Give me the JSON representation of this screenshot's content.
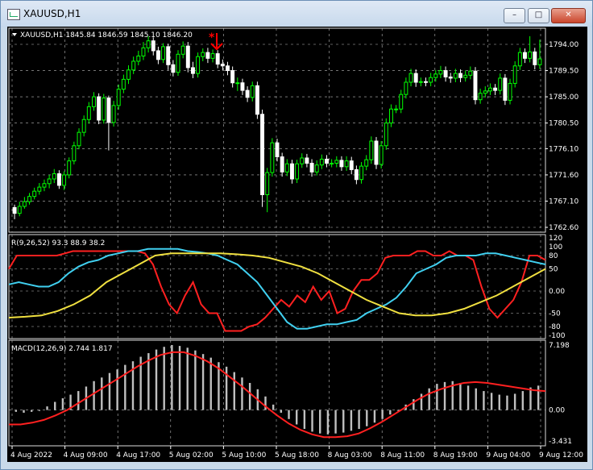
{
  "window": {
    "title": "XAUUSD,H1",
    "buttons": {
      "minimize": "–",
      "maximize": "□",
      "close": "✕"
    }
  },
  "price_panel": {
    "header": "XAUUSD,H1  1845.84 1846.59 1845.10 1846.20",
    "price_labels": [
      "1794.00",
      "1789.50",
      "1785.00",
      "1780.50",
      "1776.10",
      "1771.60",
      "1767.10",
      "1762.60"
    ]
  },
  "indicator_panel": {
    "header": "R(9,26,52) 93.3 88.9 38.2",
    "levels": [
      "120",
      "100",
      "80",
      "50",
      "0.00",
      "-50",
      "-80",
      "-100"
    ]
  },
  "macd_panel": {
    "header": "MACD(12,26,9) 2.744 1.817",
    "levels": [
      "7.198",
      "0.00",
      "-3.431"
    ]
  },
  "time_axis": [
    "4 Aug 2022",
    "4 Aug 09:00",
    "4 Aug 17:00",
    "5 Aug 02:00",
    "5 Aug 10:00",
    "5 Aug 18:00",
    "8 Aug 03:00",
    "8 Aug 11:00",
    "8 Aug 19:00",
    "9 Aug 04:00",
    "9 Aug 12:00"
  ],
  "colors": {
    "bull": "#00ff00",
    "bear": "#ffffff",
    "grid": "#bbbbbb",
    "red": "#ff2020",
    "cyan": "#40d0f0",
    "yellow": "#f0e040",
    "hist": "#c0c0c0",
    "macd_signal": "#ff2020",
    "arrow": "#ff0000"
  },
  "chart_data": [
    {
      "type": "candlestick",
      "title": "XAUUSD,H1",
      "ylim": [
        1762.6,
        1794.0
      ],
      "x": [
        "4 Aug 2022",
        "4 Aug 09:00",
        "4 Aug 17:00",
        "5 Aug 02:00",
        "5 Aug 10:00",
        "5 Aug 18:00",
        "8 Aug 03:00",
        "8 Aug 11:00",
        "8 Aug 19:00",
        "9 Aug 04:00",
        "9 Aug 12:00"
      ],
      "candles": [
        [
          1766.0,
          1765.0,
          1764.0,
          1766.5
        ],
        [
          1765.0,
          1766.2,
          1764.5,
          1767.0
        ],
        [
          1766.2,
          1767.0,
          1765.8,
          1767.8
        ],
        [
          1767.0,
          1767.9,
          1766.5,
          1768.5
        ],
        [
          1767.9,
          1768.8,
          1767.4,
          1769.4
        ],
        [
          1768.8,
          1769.5,
          1768.2,
          1770.2
        ],
        [
          1769.5,
          1770.1,
          1768.8,
          1770.8
        ],
        [
          1770.1,
          1770.9,
          1769.3,
          1771.6
        ],
        [
          1770.9,
          1771.8,
          1770.2,
          1772.6
        ],
        [
          1771.8,
          1769.8,
          1769.2,
          1772.4
        ],
        [
          1769.8,
          1771.6,
          1769.0,
          1772.2
        ],
        [
          1771.6,
          1774.0,
          1771.0,
          1774.6
        ],
        [
          1774.0,
          1776.6,
          1773.4,
          1777.3
        ],
        [
          1776.6,
          1778.9,
          1776.0,
          1779.6
        ],
        [
          1778.9,
          1781.1,
          1778.2,
          1781.8
        ],
        [
          1781.1,
          1783.3,
          1780.4,
          1784.1
        ],
        [
          1783.3,
          1785.0,
          1782.6,
          1785.8
        ],
        [
          1785.0,
          1781.0,
          1780.3,
          1785.6
        ],
        [
          1781.0,
          1784.8,
          1780.4,
          1785.5
        ],
        [
          1784.8,
          1780.6,
          1775.8,
          1785.2
        ],
        [
          1780.6,
          1783.5,
          1779.9,
          1784.3
        ],
        [
          1783.5,
          1786.3,
          1782.8,
          1787.1
        ],
        [
          1786.3,
          1788.0,
          1785.6,
          1788.8
        ],
        [
          1788.0,
          1789.6,
          1787.2,
          1790.4
        ],
        [
          1789.6,
          1791.1,
          1788.9,
          1791.9
        ],
        [
          1791.1,
          1792.0,
          1790.4,
          1792.9
        ],
        [
          1792.0,
          1793.4,
          1791.3,
          1794.4
        ],
        [
          1793.4,
          1794.6,
          1792.6,
          1795.4
        ],
        [
          1794.6,
          1792.9,
          1792.1,
          1795.2
        ],
        [
          1792.9,
          1791.4,
          1790.6,
          1793.6
        ],
        [
          1791.4,
          1793.6,
          1790.8,
          1794.2
        ],
        [
          1793.6,
          1790.5,
          1789.6,
          1794.1
        ],
        [
          1790.5,
          1789.2,
          1788.5,
          1791.3
        ],
        [
          1789.2,
          1792.3,
          1788.6,
          1793.0
        ],
        [
          1792.3,
          1793.7,
          1791.6,
          1794.5
        ],
        [
          1793.7,
          1790.0,
          1789.2,
          1794.4
        ],
        [
          1790.0,
          1789.0,
          1788.2,
          1791.0
        ],
        [
          1789.0,
          1791.9,
          1788.3,
          1792.6
        ],
        [
          1791.9,
          1792.6,
          1791.1,
          1793.3
        ],
        [
          1792.6,
          1791.6,
          1790.8,
          1793.4
        ],
        [
          1791.6,
          1792.4,
          1790.9,
          1793.1
        ],
        [
          1792.4,
          1790.6,
          1789.9,
          1793.0
        ],
        [
          1790.6,
          1790.3,
          1789.5,
          1791.4
        ],
        [
          1790.3,
          1789.5,
          1788.7,
          1791.0
        ],
        [
          1789.5,
          1787.4,
          1786.6,
          1790.2
        ],
        [
          1787.4,
          1787.4,
          1786.0,
          1788.3
        ],
        [
          1787.4,
          1786.1,
          1785.3,
          1788.1
        ],
        [
          1786.1,
          1784.9,
          1784.1,
          1786.8
        ],
        [
          1784.9,
          1786.9,
          1784.2,
          1787.6
        ],
        [
          1786.9,
          1782.0,
          1781.2,
          1787.6
        ],
        [
          1782.0,
          1768.2,
          1766.1,
          1782.8
        ],
        [
          1768.2,
          1772.0,
          1765.2,
          1772.8
        ],
        [
          1772.0,
          1777.1,
          1771.3,
          1777.9
        ],
        [
          1777.1,
          1774.7,
          1773.9,
          1777.8
        ],
        [
          1774.7,
          1772.1,
          1771.3,
          1775.4
        ],
        [
          1772.1,
          1773.5,
          1771.4,
          1774.3
        ],
        [
          1773.5,
          1770.9,
          1770.1,
          1774.2
        ],
        [
          1770.9,
          1773.5,
          1770.2,
          1774.2
        ],
        [
          1773.5,
          1774.5,
          1772.8,
          1775.3
        ],
        [
          1774.5,
          1773.6,
          1772.9,
          1775.2
        ],
        [
          1773.6,
          1772.1,
          1771.3,
          1774.3
        ],
        [
          1772.1,
          1773.3,
          1771.5,
          1774.1
        ],
        [
          1773.3,
          1774.3,
          1772.6,
          1775.1
        ],
        [
          1774.3,
          1773.6,
          1772.9,
          1775.0
        ],
        [
          1773.6,
          1773.6,
          1772.9,
          1774.3
        ],
        [
          1773.6,
          1774.1,
          1772.9,
          1774.8
        ],
        [
          1774.1,
          1773.0,
          1772.3,
          1774.8
        ],
        [
          1773.0,
          1774.0,
          1772.3,
          1774.8
        ],
        [
          1774.0,
          1772.5,
          1771.7,
          1774.7
        ],
        [
          1772.5,
          1770.8,
          1770.0,
          1773.2
        ],
        [
          1770.8,
          1773.1,
          1770.1,
          1773.8
        ],
        [
          1773.1,
          1774.2,
          1772.4,
          1775.0
        ],
        [
          1774.2,
          1777.4,
          1773.5,
          1778.2
        ],
        [
          1777.4,
          1773.4,
          1772.6,
          1778.1
        ],
        [
          1773.4,
          1776.6,
          1772.7,
          1777.4
        ],
        [
          1776.6,
          1780.5,
          1775.9,
          1781.3
        ],
        [
          1780.5,
          1782.9,
          1779.8,
          1783.7
        ],
        [
          1782.9,
          1782.9,
          1782.2,
          1783.6
        ],
        [
          1782.9,
          1785.4,
          1782.2,
          1786.2
        ],
        [
          1785.4,
          1787.5,
          1784.7,
          1788.3
        ],
        [
          1787.5,
          1789.0,
          1786.8,
          1789.8
        ],
        [
          1789.0,
          1787.5,
          1786.7,
          1789.7
        ],
        [
          1787.5,
          1787.6,
          1786.8,
          1788.3
        ],
        [
          1787.6,
          1787.5,
          1786.8,
          1788.3
        ],
        [
          1787.5,
          1788.3,
          1786.8,
          1789.1
        ],
        [
          1788.3,
          1788.9,
          1787.6,
          1789.6
        ],
        [
          1788.9,
          1789.5,
          1788.2,
          1790.3
        ],
        [
          1789.5,
          1788.4,
          1787.6,
          1790.2
        ],
        [
          1788.4,
          1788.2,
          1787.4,
          1789.1
        ],
        [
          1788.2,
          1789.0,
          1787.5,
          1789.8
        ],
        [
          1789.0,
          1788.3,
          1787.5,
          1789.7
        ],
        [
          1788.3,
          1788.7,
          1787.6,
          1789.5
        ],
        [
          1788.7,
          1789.4,
          1788.0,
          1790.2
        ],
        [
          1789.4,
          1784.5,
          1783.7,
          1790.1
        ],
        [
          1784.5,
          1785.6,
          1783.8,
          1786.4
        ],
        [
          1785.6,
          1786.0,
          1784.9,
          1786.8
        ],
        [
          1786.0,
          1786.5,
          1785.3,
          1787.3
        ],
        [
          1786.5,
          1786.1,
          1785.3,
          1787.2
        ],
        [
          1786.1,
          1788.2,
          1785.4,
          1789.0
        ],
        [
          1788.2,
          1784.4,
          1783.6,
          1788.9
        ],
        [
          1784.4,
          1787.3,
          1783.7,
          1788.1
        ],
        [
          1787.3,
          1790.3,
          1786.6,
          1791.1
        ],
        [
          1790.3,
          1792.6,
          1789.6,
          1793.4
        ],
        [
          1792.6,
          1791.6,
          1790.8,
          1793.3
        ],
        [
          1791.6,
          1792.7,
          1790.9,
          1795.4
        ],
        [
          1792.7,
          1790.5,
          1789.7,
          1793.4
        ],
        [
          1790.5,
          1791.5,
          1789.8,
          1794.8
        ]
      ]
    },
    {
      "type": "line",
      "title": "R(9,26,52)",
      "ylim": [
        -100,
        120
      ],
      "series": [
        {
          "name": "9",
          "color": "red",
          "values": [
            50,
            80,
            80,
            80,
            80,
            80,
            80,
            85,
            90,
            90,
            90,
            90,
            90,
            90,
            90,
            90,
            90,
            85,
            60,
            10,
            -30,
            -50,
            -10,
            20,
            -30,
            -50,
            -50,
            -90,
            -90,
            -90,
            -80,
            -75,
            -60,
            -40,
            -20,
            -35,
            -10,
            -25,
            10,
            -20,
            0,
            -50,
            -40,
            0,
            25,
            25,
            40,
            75,
            80,
            80,
            80,
            90,
            90,
            80,
            80,
            90,
            80,
            80,
            70,
            10,
            -40,
            -60,
            -40,
            -20,
            20,
            80,
            80,
            70
          ]
        },
        {
          "name": "26",
          "color": "cyan",
          "values": [
            15,
            20,
            15,
            10,
            10,
            20,
            40,
            55,
            65,
            70,
            80,
            85,
            90,
            90,
            95,
            95,
            95,
            95,
            90,
            88,
            85,
            80,
            70,
            60,
            40,
            20,
            -10,
            -40,
            -70,
            -85,
            -85,
            -80,
            -75,
            -75,
            -70,
            -65,
            -50,
            -40,
            -30,
            -15,
            10,
            40,
            50,
            60,
            75,
            80,
            80,
            80,
            85,
            85,
            80,
            75,
            70,
            65,
            60
          ]
        },
        {
          "name": "52",
          "color": "yellow",
          "values": [
            -60,
            -58,
            -55,
            -45,
            -30,
            -10,
            20,
            40,
            60,
            80,
            85,
            85,
            85,
            85,
            83,
            80,
            75,
            65,
            55,
            40,
            20,
            0,
            -20,
            -35,
            -50,
            -55,
            -55,
            -50,
            -40,
            -25,
            -10,
            10,
            30,
            50
          ]
        }
      ]
    },
    {
      "type": "bar",
      "title": "MACD(12,26,9)",
      "ylim": [
        -3.431,
        7.198
      ],
      "series": [
        {
          "name": "MACD",
          "values": [
            -0.2,
            -0.3,
            -0.2,
            -0.1,
            0.4,
            0.9,
            1.3,
            1.7,
            2.1,
            2.6,
            3.2,
            3.6,
            4.1,
            4.5,
            5.0,
            5.4,
            5.9,
            6.3,
            6.7,
            7.0,
            7.2,
            7.1,
            6.9,
            6.6,
            6.2,
            5.8,
            5.3,
            4.8,
            4.2,
            3.6,
            3.0,
            2.3,
            1.5,
            0.6,
            -0.3,
            -1.0,
            -1.6,
            -2.1,
            -2.4,
            -2.6,
            -2.7,
            -2.6,
            -2.5,
            -2.3,
            -2.1,
            -1.8,
            -1.4,
            -1.0,
            -0.5,
            0.0,
            0.6,
            1.2,
            1.8,
            2.4,
            2.9,
            3.1,
            3.2,
            3.0,
            2.7,
            2.4,
            2.1,
            1.9,
            1.7,
            1.6,
            1.8,
            2.1,
            2.5,
            2.7
          ]
        },
        {
          "name": "Signal",
          "values": [
            -1.6,
            -1.6,
            -1.4,
            -1.1,
            -0.6,
            0.0,
            0.8,
            1.6,
            2.4,
            3.2,
            4.0,
            4.8,
            5.5,
            6.1,
            6.4,
            6.4,
            6.0,
            5.4,
            4.6,
            3.6,
            2.6,
            1.5,
            0.4,
            -0.6,
            -1.5,
            -2.2,
            -2.7,
            -3.0,
            -3.0,
            -2.9,
            -2.6,
            -2.0,
            -1.3,
            -0.5,
            0.3,
            1.1,
            1.8,
            2.3,
            2.7,
            3.0,
            3.1,
            3.0,
            2.8,
            2.6,
            2.4,
            2.2,
            2.1
          ]
        }
      ]
    }
  ]
}
